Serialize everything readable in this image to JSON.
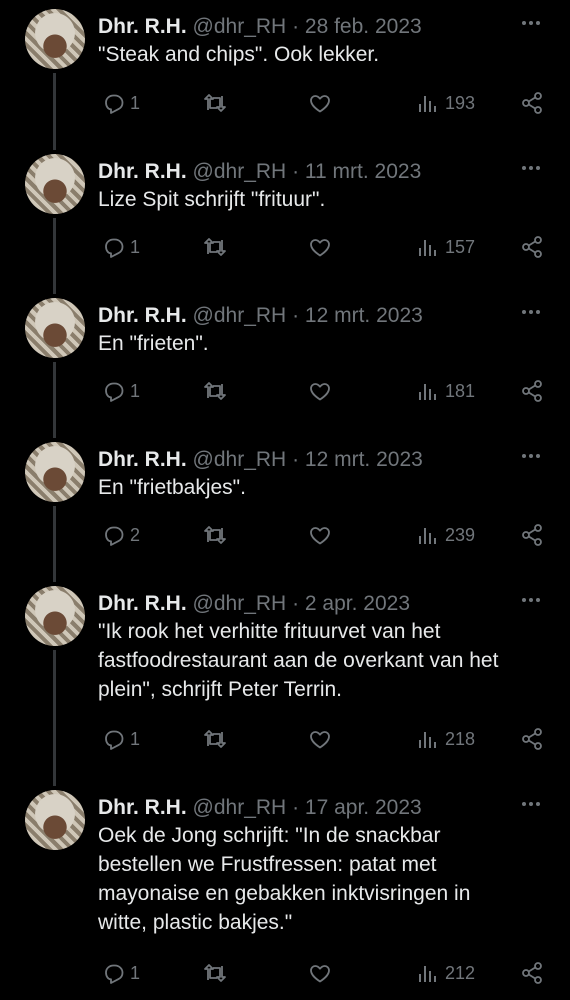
{
  "tweets": [
    {
      "name": "Dhr. R.H.",
      "handle": "@dhr_RH",
      "date": "28 feb. 2023",
      "text": "\"Steak and chips\". Ook lekker.",
      "replies": "1",
      "views": "193"
    },
    {
      "name": "Dhr. R.H.",
      "handle": "@dhr_RH",
      "date": "11 mrt. 2023",
      "text": "Lize Spit schrijft \"frituur\".",
      "replies": "1",
      "views": "157"
    },
    {
      "name": "Dhr. R.H.",
      "handle": "@dhr_RH",
      "date": "12 mrt. 2023",
      "text": "En \"frieten\".",
      "replies": "1",
      "views": "181"
    },
    {
      "name": "Dhr. R.H.",
      "handle": "@dhr_RH",
      "date": "12 mrt. 2023",
      "text": "En \"frietbakjes\".",
      "replies": "2",
      "views": "239"
    },
    {
      "name": "Dhr. R.H.",
      "handle": "@dhr_RH",
      "date": "2 apr. 2023",
      "text": "\"Ik rook het verhitte frituurvet van het\nfastfoodrestaurant aan de overkant van het\nplein\", schrijft Peter Terrin.",
      "replies": "1",
      "views": "218"
    },
    {
      "name": "Dhr. R.H.",
      "handle": "@dhr_RH",
      "date": "17 apr. 2023",
      "text": "Oek de Jong schrijft: \"In de snackbar\nbestellen we Frustfressen: patat met\nmayonaise  en gebakken inktvisringen in\nwitte, plastic bakjes.\"",
      "replies": "1",
      "views": "212"
    }
  ],
  "icons": {
    "reply": "reply-icon",
    "retweet": "retweet-icon",
    "like": "heart-icon",
    "views": "views-icon",
    "share": "share-icon",
    "more": "more-icon"
  },
  "colors": {
    "background": "#000000",
    "text": "#e7e9ea",
    "secondary": "#71767b",
    "thread_line": "#333639"
  }
}
